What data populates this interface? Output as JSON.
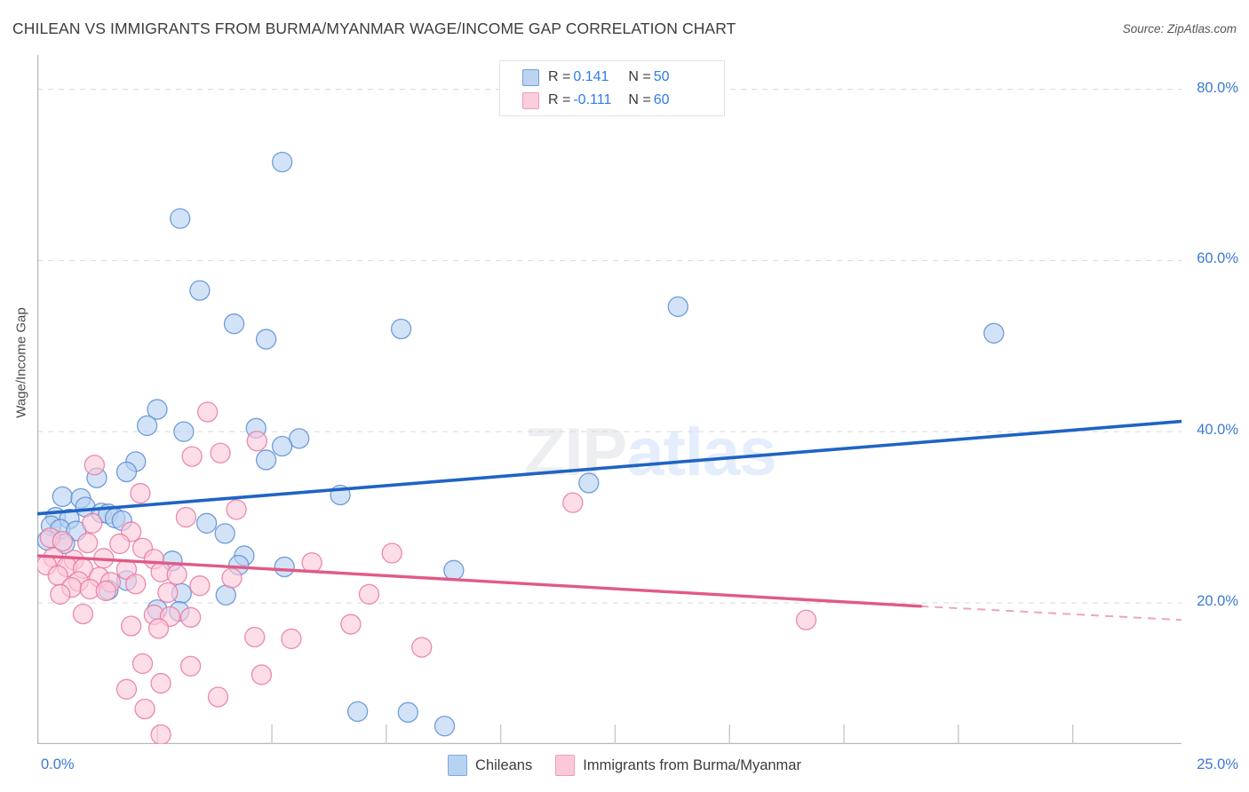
{
  "header": {
    "title": "CHILEAN VS IMMIGRANTS FROM BURMA/MYANMAR WAGE/INCOME GAP CORRELATION CHART",
    "source": "Source: ZipAtlas.com"
  },
  "watermark": {
    "zip": "ZIP",
    "atlas": "atlas"
  },
  "axes": {
    "y_title": "Wage/Income Gap",
    "y_ticks": [
      "80.0%",
      "60.0%",
      "40.0%",
      "20.0%"
    ],
    "x_min_label": "0.0%",
    "x_max_label": "25.0%"
  },
  "correlation_legend": {
    "rows": [
      {
        "r_label": "R =",
        "r_value": "0.141",
        "n_label": "N =",
        "n_value": "50",
        "color": "#bcd4f2"
      },
      {
        "r_label": "R =",
        "r_value": "-0.111",
        "n_label": "N =",
        "n_value": "60",
        "color": "#fbcedd"
      }
    ]
  },
  "series_legend": [
    {
      "name": "Chileans",
      "color": "#b8d2f2"
    },
    {
      "name": "Immigrants from Burma/Myanmar",
      "color": "#fbc8da"
    }
  ],
  "chart_data": {
    "type": "scatter",
    "title": "CHILEAN VS IMMIGRANTS FROM BURMA/MYANMAR WAGE/INCOME GAP CORRELATION CHART",
    "xlabel": "",
    "ylabel": "Wage/Income Gap",
    "xlim": [
      0.0,
      25.0
    ],
    "ylim": [
      3.5,
      84.0
    ],
    "x_ticks": [
      0.0,
      25.0
    ],
    "y_ticks": [
      20.0,
      40.0,
      60.0,
      80.0
    ],
    "grid": "horizontal-dashed",
    "legend_position": "bottom-center",
    "series": [
      {
        "name": "Chileans",
        "color": "#b8d2f2",
        "edge_color": "#5b8dd4",
        "R": 0.141,
        "N": 50,
        "trendline": {
          "x0": 0.0,
          "y0": 30.4,
          "x1": 25.0,
          "y1": 41.2,
          "style": "solid",
          "color": "#1f63c4"
        },
        "points": [
          [
            5.35,
            71.5
          ],
          [
            3.12,
            64.9
          ],
          [
            3.55,
            56.5
          ],
          [
            4.3,
            52.6
          ],
          [
            7.95,
            52.0
          ],
          [
            14.0,
            54.6
          ],
          [
            20.9,
            51.5
          ],
          [
            5.0,
            50.8
          ],
          [
            2.62,
            42.6
          ],
          [
            2.4,
            40.7
          ],
          [
            3.2,
            40.0
          ],
          [
            4.78,
            40.4
          ],
          [
            5.72,
            39.2
          ],
          [
            5.35,
            38.3
          ],
          [
            5.0,
            36.7
          ],
          [
            2.15,
            36.5
          ],
          [
            1.95,
            35.3
          ],
          [
            1.3,
            34.6
          ],
          [
            12.05,
            34.0
          ],
          [
            6.62,
            32.6
          ],
          [
            0.55,
            32.4
          ],
          [
            0.95,
            32.2
          ],
          [
            1.05,
            31.2
          ],
          [
            1.4,
            30.5
          ],
          [
            0.4,
            30.0
          ],
          [
            0.7,
            29.8
          ],
          [
            1.55,
            30.4
          ],
          [
            1.7,
            29.9
          ],
          [
            1.85,
            29.6
          ],
          [
            0.3,
            29.0
          ],
          [
            0.5,
            28.6
          ],
          [
            0.85,
            28.4
          ],
          [
            3.7,
            29.3
          ],
          [
            4.1,
            28.1
          ],
          [
            0.22,
            27.3
          ],
          [
            0.6,
            26.9
          ],
          [
            4.52,
            25.5
          ],
          [
            2.95,
            24.9
          ],
          [
            4.4,
            24.4
          ],
          [
            5.4,
            24.2
          ],
          [
            9.1,
            23.8
          ],
          [
            1.95,
            22.6
          ],
          [
            1.55,
            21.5
          ],
          [
            3.15,
            21.1
          ],
          [
            4.12,
            20.9
          ],
          [
            2.62,
            19.2
          ],
          [
            3.1,
            19.0
          ],
          [
            7.0,
            7.3
          ],
          [
            8.1,
            7.2
          ],
          [
            8.9,
            5.6
          ]
        ]
      },
      {
        "name": "Immigrants from Burma/Myanmar",
        "color": "#fbc8da",
        "edge_color": "#e8789f",
        "R": -0.111,
        "N": 60,
        "trendline": {
          "x0": 0.0,
          "y0": 25.5,
          "x1": 19.3,
          "y1": 19.6,
          "style": "solid-then-dashed",
          "dash_from": 19.3,
          "dash_to": 25.0,
          "dash_y1": 18.0,
          "color": "#e05a87"
        },
        "points": [
          [
            3.72,
            42.3
          ],
          [
            4.8,
            38.9
          ],
          [
            4.0,
            37.5
          ],
          [
            1.25,
            36.1
          ],
          [
            3.38,
            37.1
          ],
          [
            2.25,
            32.8
          ],
          [
            11.7,
            31.7
          ],
          [
            4.35,
            30.9
          ],
          [
            3.25,
            30.0
          ],
          [
            1.2,
            29.3
          ],
          [
            2.05,
            28.3
          ],
          [
            0.28,
            27.6
          ],
          [
            0.55,
            27.2
          ],
          [
            1.1,
            27.0
          ],
          [
            1.8,
            26.9
          ],
          [
            2.3,
            26.4
          ],
          [
            7.75,
            25.8
          ],
          [
            0.35,
            25.3
          ],
          [
            0.8,
            25.0
          ],
          [
            1.45,
            25.2
          ],
          [
            2.55,
            25.1
          ],
          [
            6.0,
            24.7
          ],
          [
            0.2,
            24.4
          ],
          [
            0.65,
            24.2
          ],
          [
            1.0,
            24.0
          ],
          [
            1.95,
            23.9
          ],
          [
            2.7,
            23.6
          ],
          [
            3.05,
            23.3
          ],
          [
            0.45,
            23.2
          ],
          [
            1.35,
            23.0
          ],
          [
            4.25,
            22.9
          ],
          [
            0.9,
            22.5
          ],
          [
            1.6,
            22.4
          ],
          [
            2.15,
            22.2
          ],
          [
            3.55,
            22.0
          ],
          [
            0.75,
            21.8
          ],
          [
            1.15,
            21.6
          ],
          [
            1.5,
            21.4
          ],
          [
            2.85,
            21.2
          ],
          [
            0.5,
            21.0
          ],
          [
            7.25,
            21.0
          ],
          [
            16.8,
            18.0
          ],
          [
            1.0,
            18.7
          ],
          [
            2.55,
            18.6
          ],
          [
            2.9,
            18.4
          ],
          [
            3.35,
            18.3
          ],
          [
            6.85,
            17.5
          ],
          [
            2.05,
            17.3
          ],
          [
            2.65,
            17.0
          ],
          [
            4.75,
            16.0
          ],
          [
            5.55,
            15.8
          ],
          [
            8.4,
            14.8
          ],
          [
            2.3,
            12.9
          ],
          [
            3.35,
            12.6
          ],
          [
            4.9,
            11.6
          ],
          [
            2.7,
            10.6
          ],
          [
            1.95,
            9.9
          ],
          [
            3.95,
            9.0
          ],
          [
            2.35,
            7.6
          ],
          [
            2.7,
            4.6
          ]
        ]
      }
    ]
  }
}
